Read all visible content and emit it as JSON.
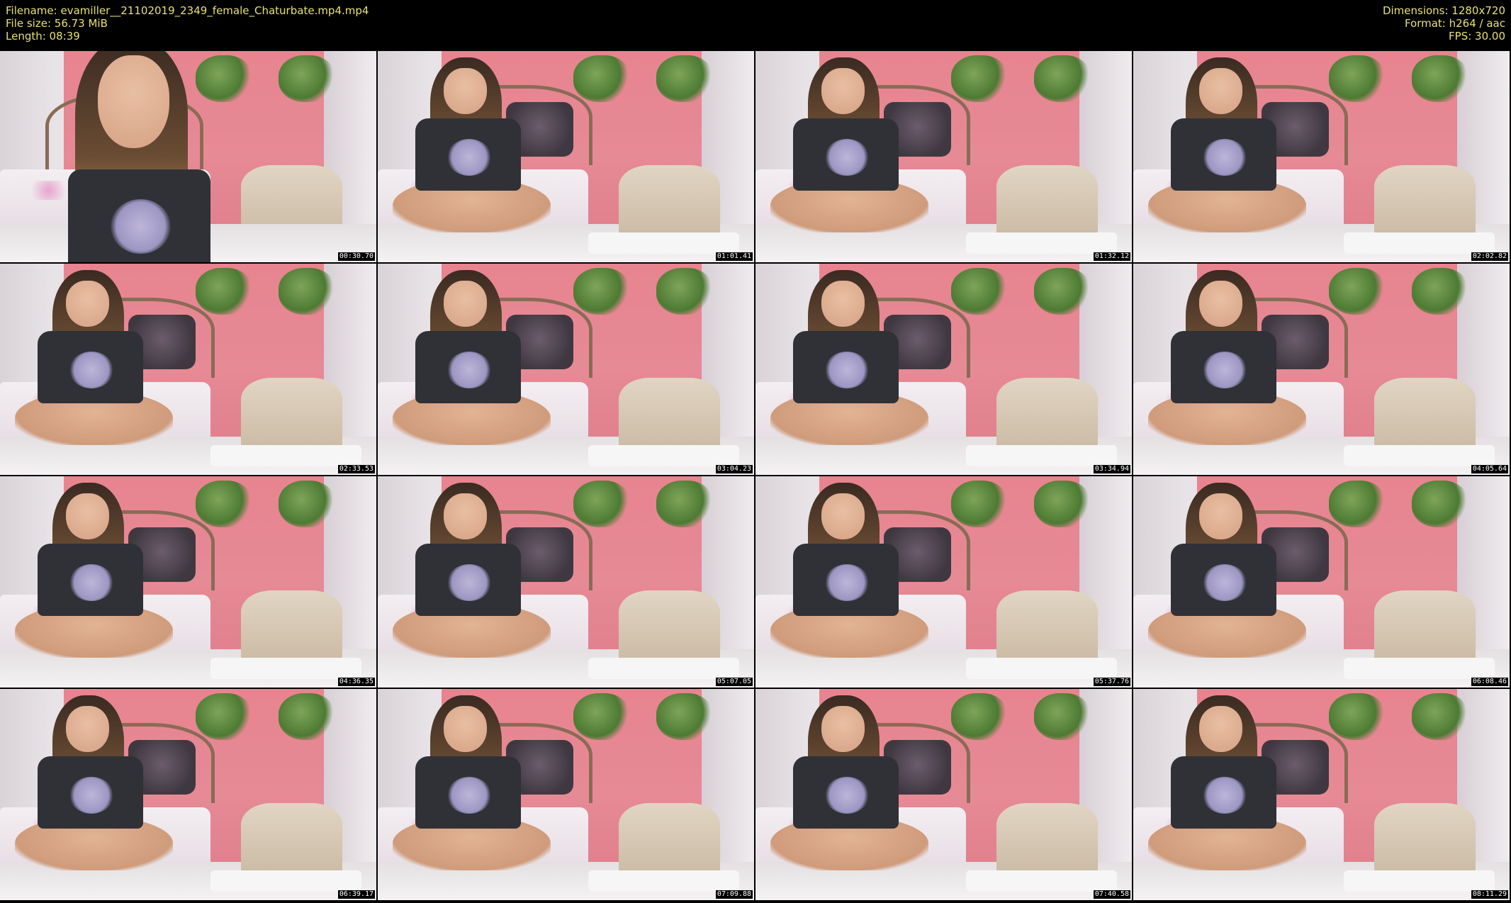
{
  "header": {
    "filename": "Filename: evamiller__21102019_2349_female_Chaturbate.mp4.mp4",
    "file_size": "File size: 56.73 MiB",
    "length": "Length: 08:39",
    "dimensions": "Dimensions: 1280x720",
    "format": "Format: h264 / aac",
    "fps": "FPS: 30.00"
  },
  "colors": {
    "header_text": "#e8e070",
    "background": "#000000",
    "timestamp_text": "#ffffff"
  },
  "thumbnails": [
    {
      "timestamp": "00:30.70"
    },
    {
      "timestamp": "01:01.41"
    },
    {
      "timestamp": "01:32.12"
    },
    {
      "timestamp": "02:02.82"
    },
    {
      "timestamp": "02:33.53"
    },
    {
      "timestamp": "03:04.23"
    },
    {
      "timestamp": "03:34.94"
    },
    {
      "timestamp": "04:05.64"
    },
    {
      "timestamp": "04:36.35"
    },
    {
      "timestamp": "05:07.05"
    },
    {
      "timestamp": "05:37.76"
    },
    {
      "timestamp": "06:08.46"
    },
    {
      "timestamp": "06:39.17"
    },
    {
      "timestamp": "07:09.88"
    },
    {
      "timestamp": "07:40.58"
    },
    {
      "timestamp": "08:11.29"
    }
  ]
}
